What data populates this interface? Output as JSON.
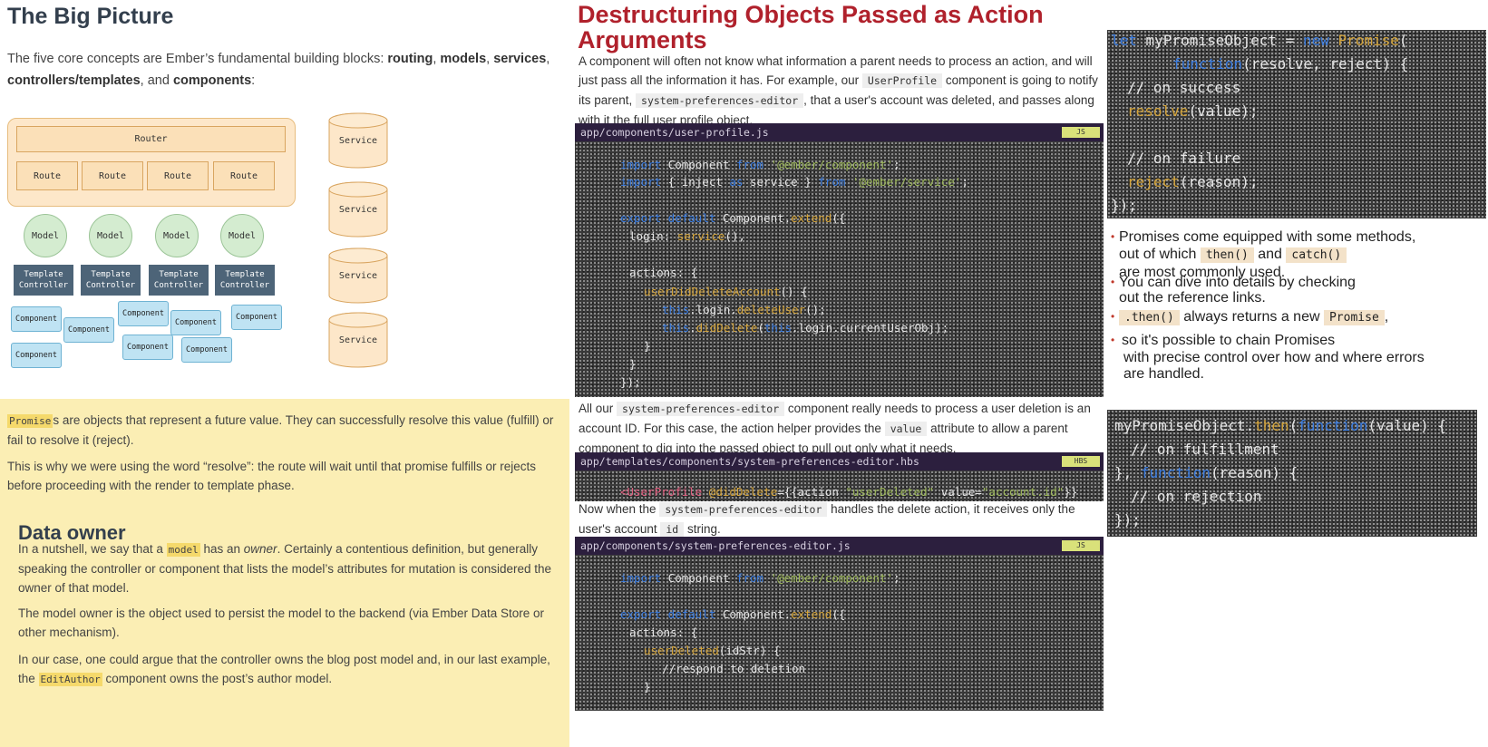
{
  "left": {
    "title": "The Big Picture",
    "intro_pre": "The five core concepts are Ember’s fundamental building blocks: ",
    "routing": "routing",
    "comma1": ", ",
    "models": "models",
    "comma2": ", ",
    "services": "services",
    "comma3": ", ",
    "controllers": "controllers/templates",
    "and": ", and ",
    "components": "components",
    "colon": ":",
    "diagram": {
      "router": "Router",
      "routes": [
        "Route",
        "Route",
        "Route",
        "Route"
      ],
      "models": [
        "Model",
        "Model",
        "Model",
        "Model"
      ],
      "tc_line1": "Template",
      "tc_line2": "Controller",
      "components": [
        "Component",
        "Component",
        "Component",
        "Component",
        "Component",
        "Component",
        "Component",
        "Component"
      ],
      "services": [
        "Service",
        "Service",
        "Service",
        "Service"
      ]
    },
    "promise_code": "Promise",
    "promise_text": "s are objects that represent a future value. They can successfully resolve this value (fulfill) or fail to resolve it (reject).",
    "resolve_text": "This is why we were using the word “resolve”: the route will wait until that promise fulfills or rejects before proceeding with the render to template phase.",
    "owner_title": "Data owner",
    "owner_p1_pre": "In a nutshell, we say that a ",
    "owner_p1_code": "model",
    "owner_p1_mid": " has an ",
    "owner_p1_em": "owner",
    "owner_p1_post": ". Certainly a contentious definition, but generally speaking the controller or component that lists the model’s attributes for mutation is considered the owner of that model.",
    "owner_p2": "The model owner is the object used to persist the model to the backend (via Ember Data Store or other mechanism).",
    "owner_p3_pre": "In our case, one could argue that the controller owns the blog post model and, in our last example, the ",
    "owner_p3_code": "EditAuthor",
    "owner_p3_post": " component owns the post’s author model."
  },
  "mid": {
    "title": "Destructuring Objects Passed as Action Arguments",
    "p1_a": "A component will often not know what information a parent needs to process an action, and will just pass all the information it has. For example, our ",
    "p1_code1": "UserProfile",
    "p1_b": " component is going to notify its parent, ",
    "p1_code2": "system-preferences-editor",
    "p1_c": ", that a user's account was deleted, and passes along with it the full user profile object.",
    "file1": "app/components/user-profile.js",
    "file1_lang": "JS",
    "p2_a": "All our ",
    "p2_code1": "system-preferences-editor",
    "p2_b": " component really needs to process a user deletion is an account ID. For this case, the action helper provides the ",
    "p2_code2": "value",
    "p2_c": " attribute to allow a parent component to dig into the passed object to pull out only what it needs.",
    "file2": "app/templates/components/system-preferences-editor.hbs",
    "file2_lang": "HBS",
    "p3_a": "Now when the ",
    "p3_code1": "system-preferences-editor",
    "p3_b": " handles the delete action, it receives only the user's account ",
    "p3_code2": "id",
    "p3_c": " string.",
    "file3": "app/components/system-preferences-editor.js",
    "file3_lang": "JS"
  },
  "right": {
    "b1_pre": "Promises come equipped with some methods,",
    "b1_line2_pre": "out of which ",
    "b1_code1": "then()",
    "b1_and": " and ",
    "b1_code2": "catch()",
    "b1_line3": "are most commonly used.",
    "b2_line1": "You can dive into details by checking",
    "b2_line2": "out the reference links.",
    "b3_code1": ".then()",
    "b3_mid": " always returns a new ",
    "b3_code2": "Promise",
    "b3_post": ",",
    "b4_line1": "so it's possible to chain Promises",
    "b4_line2": "with precise control over how and where errors",
    "b4_line3": "are handled."
  },
  "colors": {
    "accent_red": "#b0212c",
    "header_purple": "#2c1f3e",
    "yellow_panel": "#fbeeb4"
  }
}
